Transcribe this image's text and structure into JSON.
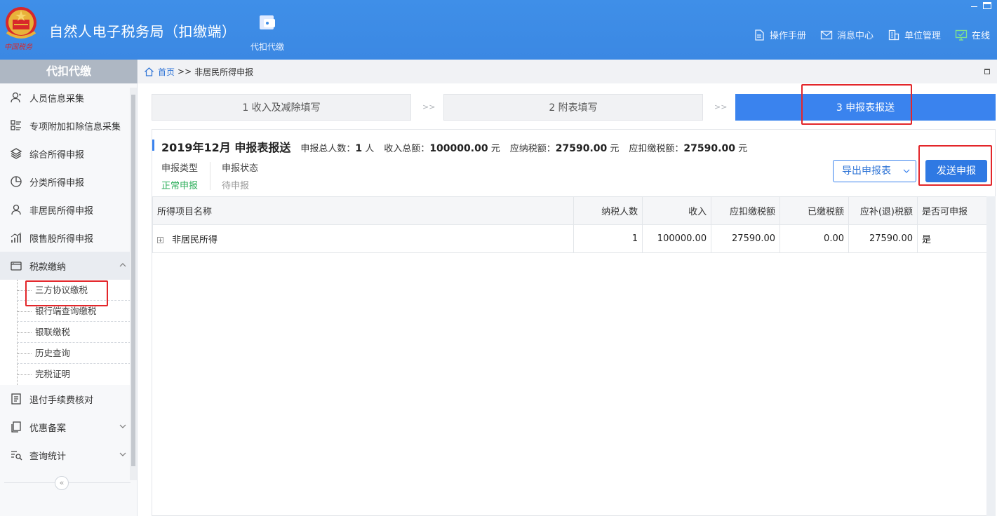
{
  "header": {
    "logo_text": "中国税务",
    "title": "自然人电子税务局（扣缴端）",
    "nav_item": "代扣代缴",
    "links": [
      {
        "label": "操作手册",
        "icon": "manual-icon"
      },
      {
        "label": "消息中心",
        "icon": "mail-icon"
      },
      {
        "label": "单位管理",
        "icon": "building-icon"
      },
      {
        "label": "在线",
        "icon": "monitor-icon"
      }
    ]
  },
  "sidebar": {
    "title": "代扣代缴",
    "items": [
      {
        "label": "人员信息采集",
        "icon": "person-icon"
      },
      {
        "label": "专项附加扣除信息采集",
        "icon": "list-icon"
      },
      {
        "label": "综合所得申报",
        "icon": "layers-icon"
      },
      {
        "label": "分类所得申报",
        "icon": "pie-icon"
      },
      {
        "label": "非居民所得申报",
        "icon": "person-icon"
      },
      {
        "label": "限售股所得申报",
        "icon": "bar-chart-icon"
      },
      {
        "label": "税款缴纳",
        "icon": "wallet-icon",
        "expanded": true
      },
      {
        "label": "退付手续费核对",
        "icon": "document-icon"
      },
      {
        "label": "优惠备案",
        "icon": "copy-icon"
      },
      {
        "label": "查询统计",
        "icon": "search-list-icon"
      }
    ],
    "sub_items": [
      "三方协议缴税",
      "银行端查询缴税",
      "银联缴税",
      "历史查询",
      "完税证明"
    ]
  },
  "breadcrumb": {
    "home": "首页",
    "separator": ">>",
    "current": "非居民所得申报"
  },
  "steps": [
    {
      "label": "1 收入及减除填写",
      "active": false
    },
    {
      "label": "2 附表填写",
      "active": false
    },
    {
      "label": "3 申报表报送",
      "active": true
    }
  ],
  "step_arrow": ">>",
  "report": {
    "title": "2019年12月 申报表报送",
    "total_people_label": "申报总人数：",
    "total_people": "1",
    "total_people_unit": "人",
    "income_label": "收入总额：",
    "income": "100000.00",
    "income_unit": "元",
    "tax_payable_label": "应纳税额：",
    "tax_payable": "27590.00",
    "tax_payable_unit": "元",
    "tax_withheld_label": "应扣缴税额：",
    "tax_withheld": "27590.00",
    "tax_withheld_unit": "元",
    "type_label": "申报类型",
    "type_value": "正常申报",
    "status_label": "申报状态",
    "status_value": "待申报",
    "export_button": "导出申报表",
    "send_button": "发送申报"
  },
  "table": {
    "headers": [
      "所得项目名称",
      "纳税人数",
      "收入",
      "应扣缴税额",
      "已缴税额",
      "应补(退)税额",
      "是否可申报"
    ],
    "rows": [
      [
        "非居民所得",
        "1",
        "100000.00",
        "27590.00",
        "0.00",
        "27590.00",
        "是"
      ]
    ],
    "expand_symbol": "+"
  },
  "colors": {
    "header_bg": "#3d8ce6",
    "accent": "#3a83ee",
    "success": "#2cae5a",
    "highlight": "#e3262a"
  }
}
